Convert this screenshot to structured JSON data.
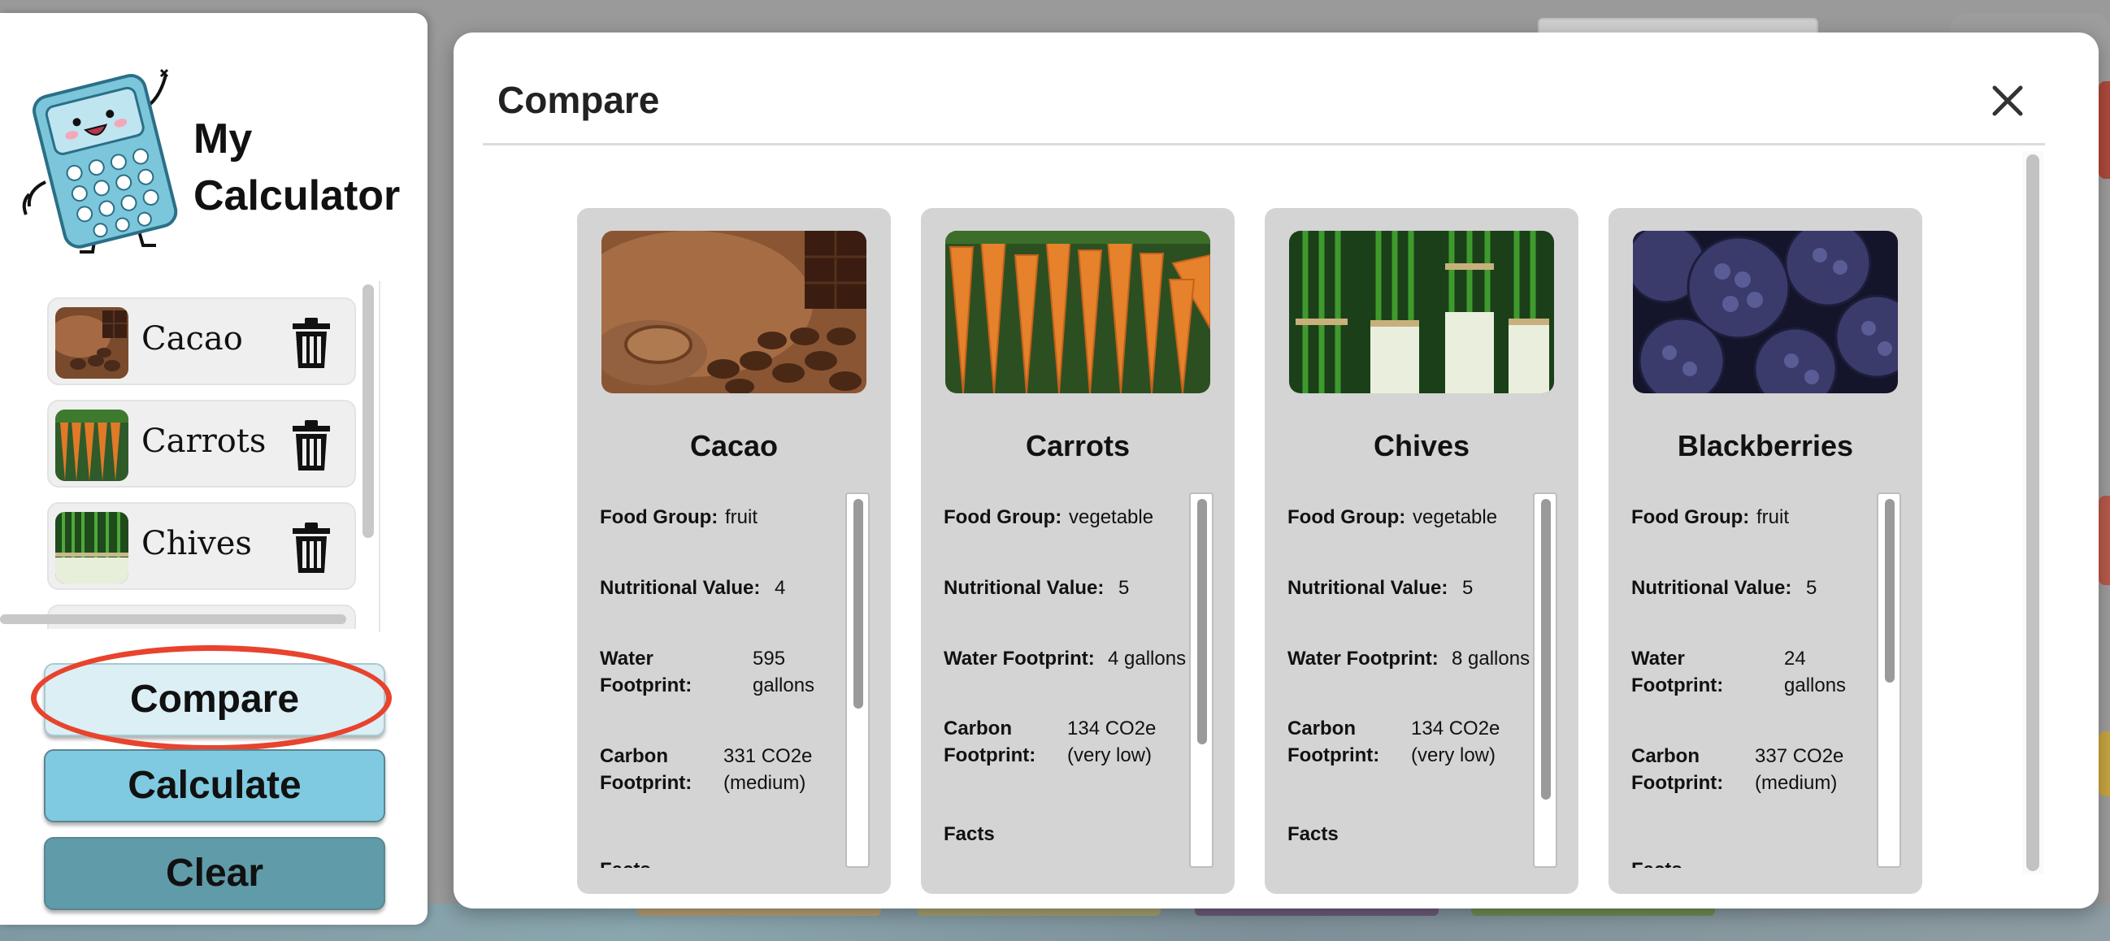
{
  "app": {
    "title": "My Calculator"
  },
  "sidebar": {
    "items": [
      {
        "label": "Cacao",
        "image": "cacao"
      },
      {
        "label": "Carrots",
        "image": "carrots"
      },
      {
        "label": "Chives",
        "image": "chives"
      }
    ],
    "delete_icon": "trash-icon",
    "buttons": {
      "compare": "Compare",
      "calculate": "Calculate",
      "clear": "Clear"
    }
  },
  "modal": {
    "title": "Compare",
    "close_icon": "close-icon",
    "labels": {
      "food_group": "Food Group:",
      "nutritional_value": "Nutritional Value:",
      "water_footprint": "Water Footprint:",
      "water": "Water",
      "footprint": "Footprint:",
      "carbon": "Carbon",
      "facts": "Facts"
    },
    "cards": [
      {
        "name": "Cacao",
        "food_group": "fruit",
        "nutritional_value": "4",
        "water_value_1": "595",
        "water_value_2": "gallons",
        "carbon_value_1": "331 CO2e",
        "carbon_value_2": "(medium)"
      },
      {
        "name": "Carrots",
        "food_group": "vegetable",
        "nutritional_value": "5",
        "water_value": "4 gallons",
        "carbon_value_1": "134 CO2e",
        "carbon_value_2": "(very low)"
      },
      {
        "name": "Chives",
        "food_group": "vegetable",
        "nutritional_value": "5",
        "water_value": "8 gallons",
        "carbon_value_1": "134 CO2e",
        "carbon_value_2": "(very low)"
      },
      {
        "name": "Blackberries",
        "food_group": "fruit",
        "nutritional_value": "5",
        "water_value_1": "24",
        "water_value_2": "gallons",
        "carbon_value_1": "337 CO2e",
        "carbon_value_2": "(medium)"
      }
    ]
  },
  "colors": {
    "compare_button": "#dbeff5",
    "calculate_button": "#7fcae0",
    "clear_button": "#5f9ba9",
    "highlight": "#e8432d",
    "card_background": "#d4d4d4"
  }
}
